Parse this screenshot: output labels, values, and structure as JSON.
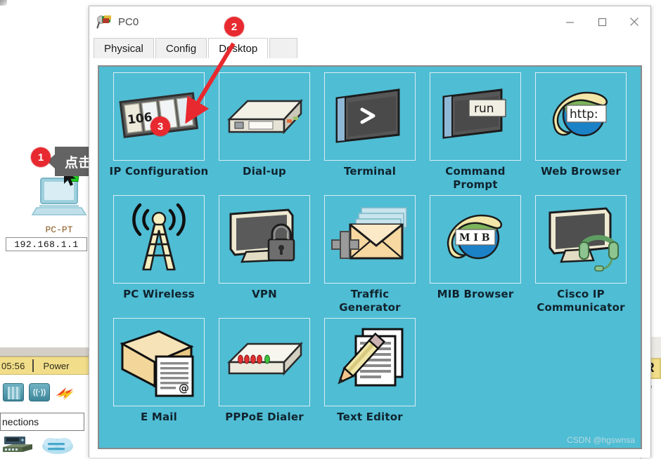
{
  "window": {
    "title": "PC0",
    "title_icon": "packet-tracer-device-icon",
    "controls": {
      "minimize": "—",
      "maximize": "☐",
      "close": "✕"
    }
  },
  "tabs": [
    {
      "label": "Physical",
      "active": false
    },
    {
      "label": "Config",
      "active": false
    },
    {
      "label": "Desktop",
      "active": true
    }
  ],
  "desktop": {
    "background_color": "#4fbdd4",
    "apps": [
      {
        "label": "IP Configuration",
        "icon": "ip-configuration-icon"
      },
      {
        "label": "Dial-up",
        "icon": "modem-icon"
      },
      {
        "label": "Terminal",
        "icon": "terminal-icon"
      },
      {
        "label": "Command Prompt",
        "icon": "command-prompt-icon"
      },
      {
        "label": "Web Browser",
        "icon": "web-browser-icon"
      },
      {
        "label": "PC Wireless",
        "icon": "wireless-antenna-icon"
      },
      {
        "label": "VPN",
        "icon": "vpn-lock-icon"
      },
      {
        "label": "Traffic Generator",
        "icon": "traffic-generator-icon"
      },
      {
        "label": "MIB Browser",
        "icon": "mib-browser-icon"
      },
      {
        "label": "Cisco IP Communicator",
        "icon": "ip-communicator-icon"
      },
      {
        "label": "E Mail",
        "icon": "email-icon"
      },
      {
        "label": "PPPoE Dialer",
        "icon": "pppoe-dialer-icon"
      },
      {
        "label": "Text Editor",
        "icon": "text-editor-icon"
      }
    ],
    "icon_badge_text": "106",
    "command_prompt_badge": "run",
    "web_browser_badge": "http:",
    "mib_badge": "M I B"
  },
  "annotations": {
    "badges": [
      {
        "number": "1",
        "target": "pc-device"
      },
      {
        "number": "2",
        "target": "desktop-tab"
      },
      {
        "number": "3",
        "target": "ip-configuration-app"
      }
    ],
    "tooltip": "点击pc机",
    "accent_color": "#e8292f"
  },
  "workspace": {
    "device_type": "PC-PT",
    "device_name": "PC0",
    "device_ip": "192.168.1.1"
  },
  "packet_tracer": {
    "status_time": "05:56",
    "status_power": "Power",
    "connections_label": "nections",
    "realtime_button": "R",
    "realtime_label": "De"
  },
  "watermark": "CSDN @hgswnsa"
}
